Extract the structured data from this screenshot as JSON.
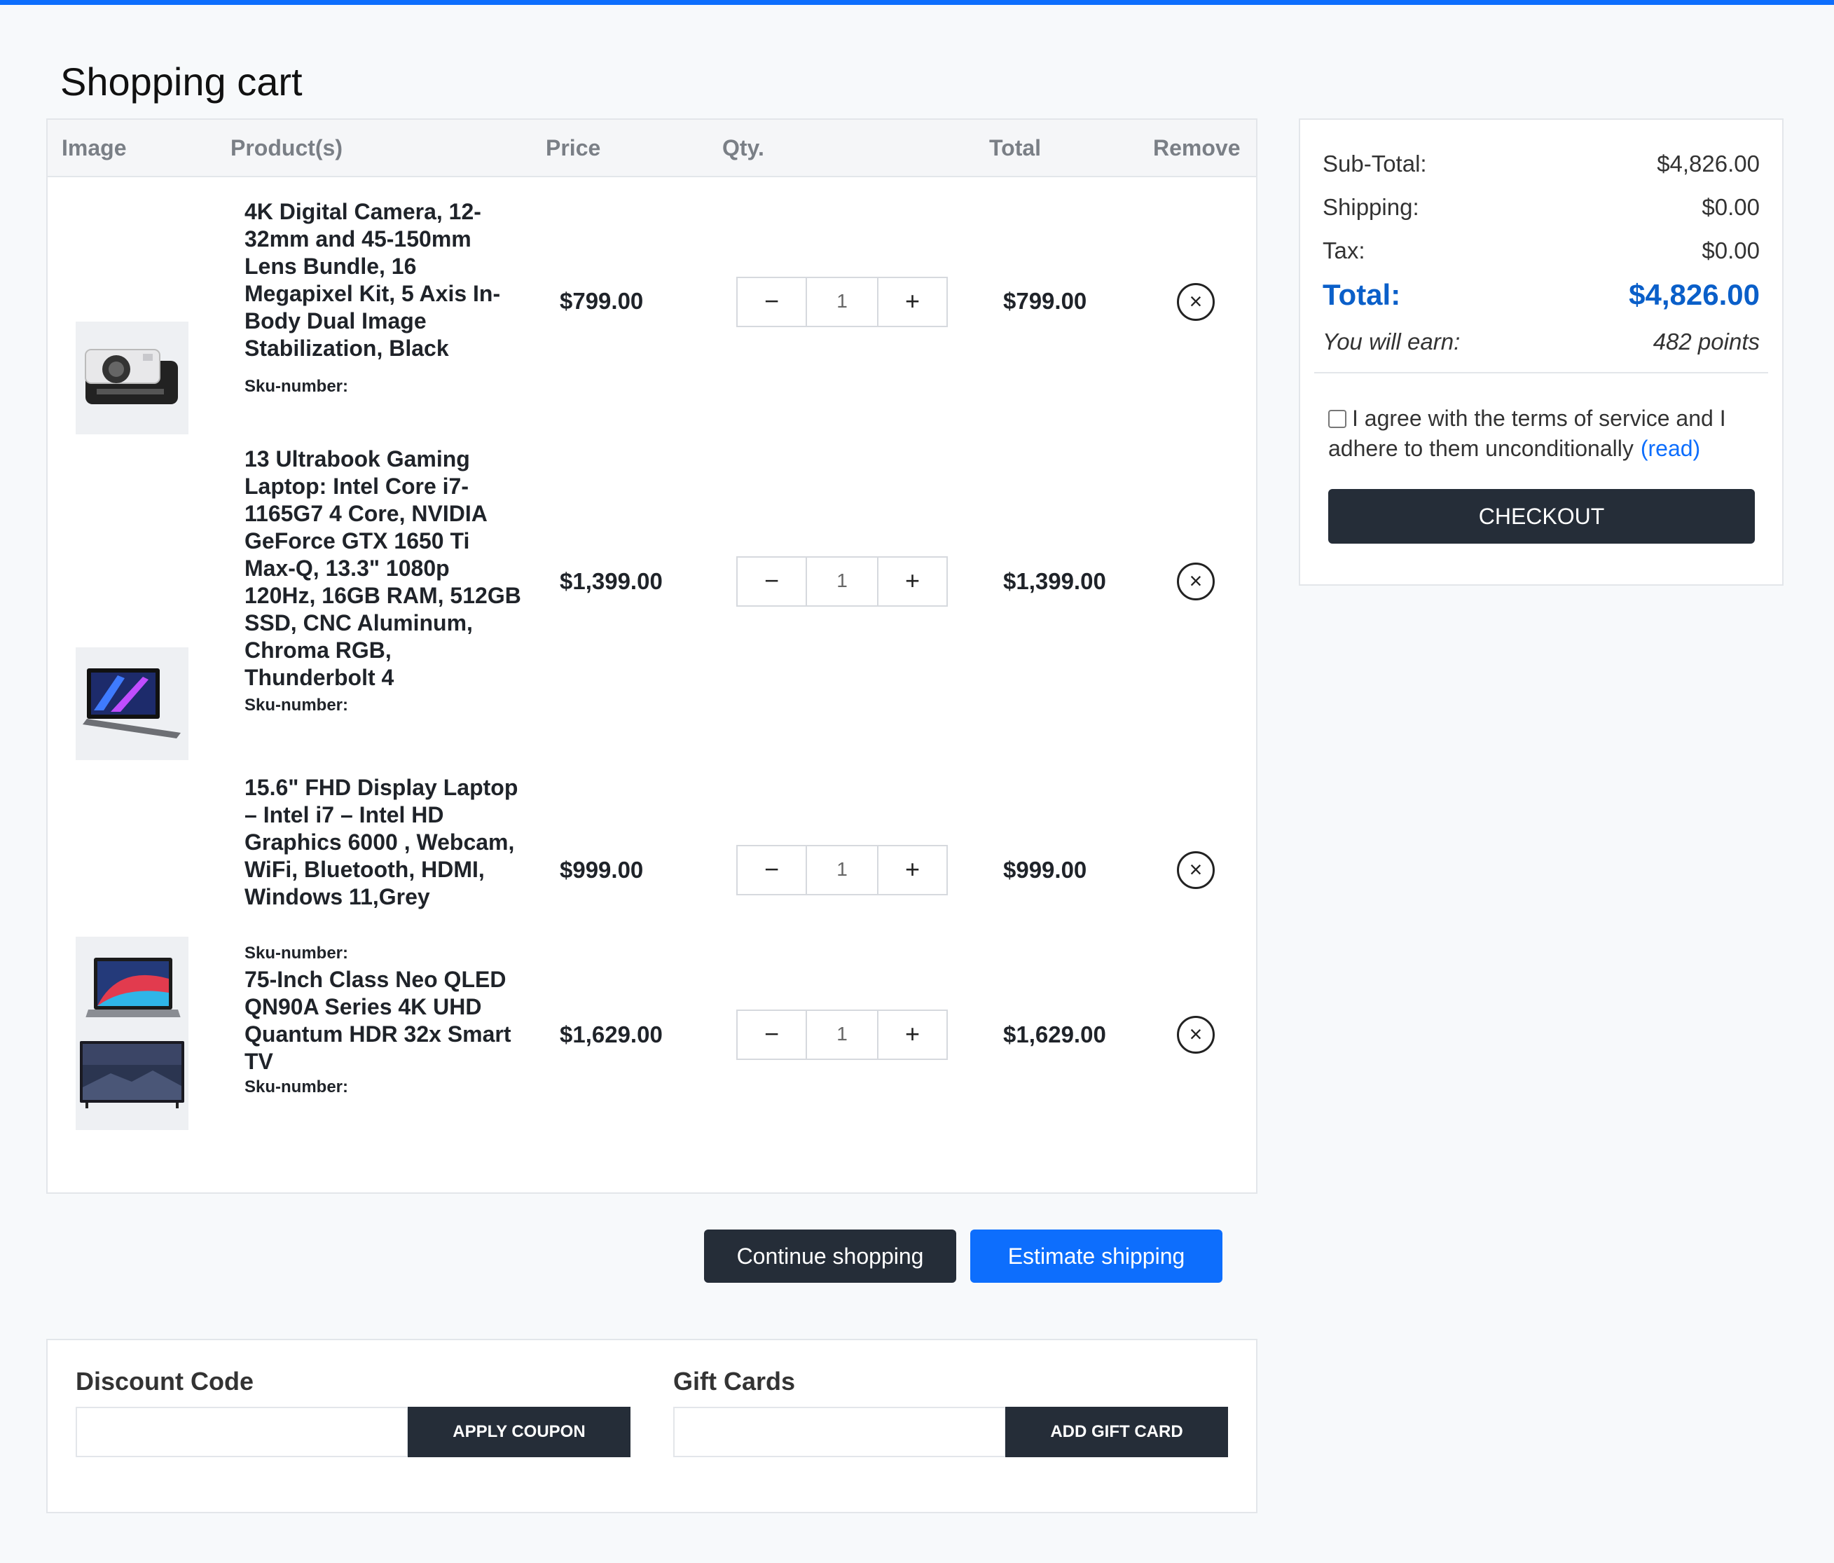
{
  "page": {
    "title": "Shopping cart"
  },
  "table": {
    "headers": {
      "image": "Image",
      "products": "Product(s)",
      "price": "Price",
      "qty": "Qty.",
      "total": "Total",
      "remove": "Remove"
    }
  },
  "cart": {
    "items": [
      {
        "name": "4K Digital Camera, 12-32mm and 45-150mm Lens Bundle, 16 Megapixel Kit, 5 Axis In-Body Dual Image Stabilization, Black",
        "sku": "Sku-number:",
        "price": "$799.00",
        "qty": "1",
        "total": "$799.00",
        "icon": "camera-icon"
      },
      {
        "name": "13 Ultrabook Gaming Laptop: Intel Core i7-1165G7 4 Core, NVIDIA GeForce GTX 1650 Ti Max-Q, 13.3\" 1080p 120Hz, 16GB RAM, 512GB SSD, CNC Aluminum, Chroma RGB, Thunderbolt 4",
        "sku": "Sku-number:",
        "price": "$1,399.00",
        "qty": "1",
        "total": "$1,399.00",
        "icon": "laptop-icon"
      },
      {
        "name": "15.6\" FHD Display Laptop – Intel i7 – Intel HD Graphics 6000 , Webcam, WiFi, Bluetooth, HDMI, Windows 11,Grey",
        "sku": "Sku-number:",
        "price": "$999.00",
        "qty": "1",
        "total": "$999.00",
        "icon": "laptop-icon"
      },
      {
        "name": "75-Inch Class Neo QLED QN90A Series 4K UHD Quantum HDR 32x Smart TV",
        "sku": "Sku-number:",
        "price": "$1,629.00",
        "qty": "1",
        "total": "$1,629.00",
        "icon": "tv-icon"
      }
    ],
    "minus_label": "−",
    "plus_label": "+",
    "remove_label": "×"
  },
  "actions": {
    "continue_label": "Continue shopping",
    "estimate_label": "Estimate shipping"
  },
  "coupons": {
    "discount_title": "Discount Code",
    "discount_button": "APPLY COUPON",
    "discount_value": "",
    "gift_title": "Gift Cards",
    "gift_button": "ADD GIFT CARD",
    "gift_value": ""
  },
  "summary": {
    "subtotal_label": "Sub-Total:",
    "subtotal_value": "$4,826.00",
    "shipping_label": "Shipping:",
    "shipping_value": "$0.00",
    "tax_label": "Tax:",
    "tax_value": "$0.00",
    "total_label": "Total:",
    "total_value": "$4,826.00",
    "earn_label": "You will earn:",
    "earn_value": "482 points",
    "terms_text": "I agree with the terms of service and I adhere to them unconditionally",
    "terms_link": "(read)",
    "terms_checked": false,
    "checkout_label": "CHECKOUT"
  },
  "colors": {
    "accent": "#0d6efd",
    "dark_button": "#252d38",
    "total_blue": "#0a5fc9"
  }
}
